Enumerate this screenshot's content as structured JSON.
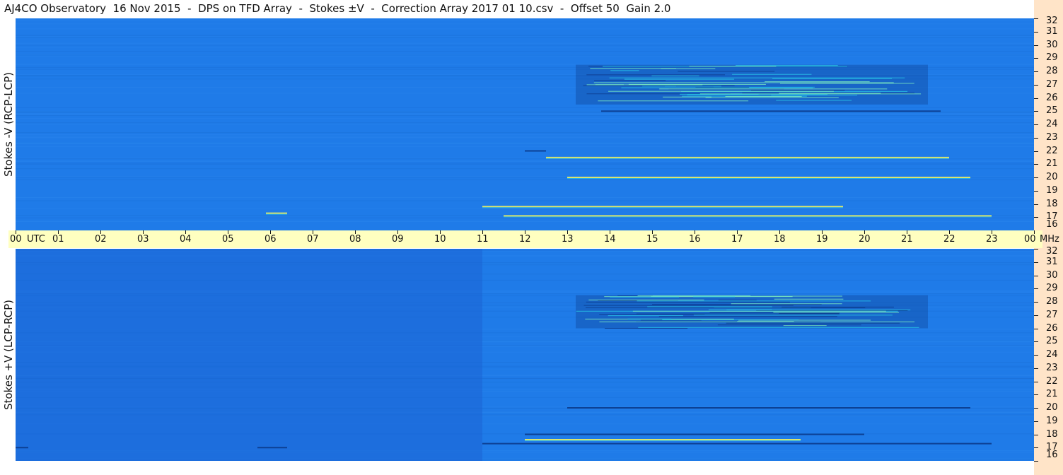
{
  "title": "AJ4CO Observatory  16 Nov 2015  -  DPS on TFD Array  -  Stokes ±V  -  Correction Array 2017 01 10.csv  -  Offset 50  Gain 2.0",
  "colors": {
    "background_blue": "#1f7be8",
    "dark_blue": "#0b3b8c",
    "cyan": "#29c8e8",
    "yellow": "#f0f060",
    "time_axis_bg": "#ffffc0",
    "freq_axis_bg": "#ffe4c8"
  },
  "chart_data": [
    {
      "type": "heatmap",
      "panel": "top",
      "ylabel": "Stokes -V (RCP-LCP)",
      "x_unit": "UTC",
      "x_range": [
        0,
        24
      ],
      "y_unit": "MHz",
      "y_range": [
        16,
        32
      ],
      "y_ticks": [
        "32",
        "31",
        "30",
        "29",
        "28",
        "27",
        "26",
        "25",
        "24",
        "23",
        "22",
        "21",
        "20",
        "19",
        "18",
        "17",
        "16"
      ],
      "features": [
        {
          "kind": "activity_region",
          "x": [
            13.2,
            21.5
          ],
          "y": [
            25.5,
            28.5
          ],
          "intensity": "high"
        },
        {
          "kind": "bright_band",
          "freq": 17.8,
          "x": [
            11.0,
            19.5
          ]
        },
        {
          "kind": "bright_band",
          "freq": 17.1,
          "x": [
            11.5,
            23.0
          ]
        },
        {
          "kind": "dark_line",
          "freq": 25.0,
          "x": [
            13.8,
            21.8
          ]
        },
        {
          "kind": "dark_line",
          "freq": 22.0,
          "x": [
            12.0,
            12.5
          ]
        },
        {
          "kind": "bright_band",
          "freq": 21.5,
          "x": [
            12.5,
            22.0
          ]
        },
        {
          "kind": "bright_band",
          "freq": 20.0,
          "x": [
            13.0,
            22.5
          ]
        },
        {
          "kind": "bright_band",
          "freq": 17.3,
          "x": [
            5.9,
            6.4
          ]
        }
      ]
    },
    {
      "type": "heatmap",
      "panel": "bottom",
      "ylabel": "Stokes +V (LCP-RCP)",
      "x_unit": "UTC",
      "x_range": [
        0,
        24
      ],
      "y_unit": "MHz",
      "y_range": [
        16,
        32
      ],
      "y_ticks": [
        "32",
        "31",
        "30",
        "29",
        "28",
        "27",
        "26",
        "25",
        "24",
        "23",
        "22",
        "21",
        "20",
        "19",
        "18",
        "17",
        "16"
      ],
      "features": [
        {
          "kind": "activity_region",
          "x": [
            13.2,
            21.5
          ],
          "y": [
            26.0,
            28.5
          ],
          "intensity": "high"
        },
        {
          "kind": "dark_line",
          "freq": 17.3,
          "x": [
            11.0,
            23.0
          ]
        },
        {
          "kind": "bright_band",
          "freq": 17.6,
          "x": [
            12.0,
            18.5
          ]
        },
        {
          "kind": "dark_line",
          "freq": 20.0,
          "x": [
            13.0,
            22.5
          ]
        },
        {
          "kind": "dark_line",
          "freq": 18.0,
          "x": [
            12.0,
            20.0
          ]
        },
        {
          "kind": "dark_line",
          "freq": 17.0,
          "x": [
            0.0,
            0.3
          ]
        },
        {
          "kind": "dark_line",
          "freq": 17.0,
          "x": [
            5.7,
            6.4
          ]
        }
      ]
    }
  ],
  "time_axis": {
    "labels": [
      "00",
      "01",
      "02",
      "03",
      "04",
      "05",
      "06",
      "07",
      "08",
      "09",
      "10",
      "11",
      "12",
      "13",
      "14",
      "15",
      "16",
      "17",
      "18",
      "19",
      "20",
      "21",
      "22",
      "23",
      "00"
    ],
    "unit_left": "UTC",
    "unit_right": "MHz"
  }
}
